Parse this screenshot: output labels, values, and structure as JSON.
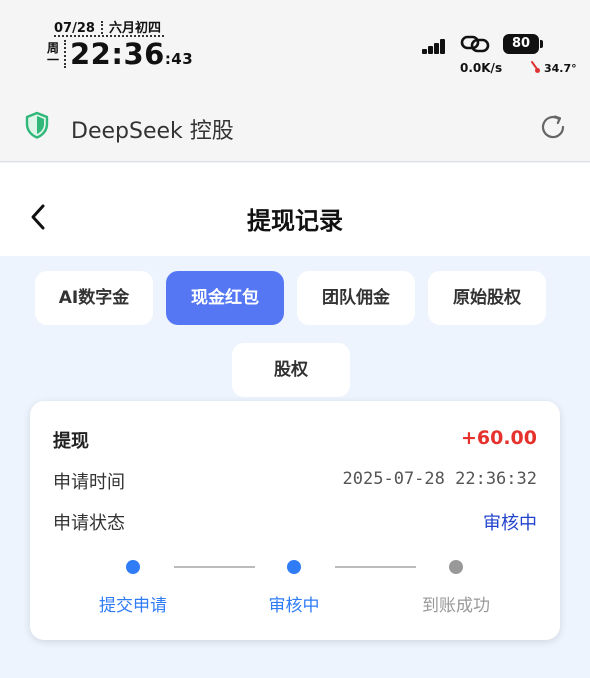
{
  "status_bar": {
    "date": "07/28",
    "lunar": "六月初四",
    "weekday": "周一",
    "time": "22:36",
    "seconds": ":43",
    "network_speed": "0.0K/s",
    "battery": "80",
    "temperature": "34.7°",
    "icons": [
      "signal-icon",
      "link-icon",
      "battery-icon",
      "thermometer-icon"
    ]
  },
  "app_bar": {
    "title": "DeepSeek 控股",
    "icons": [
      "shield-icon",
      "refresh-icon"
    ]
  },
  "header": {
    "title": "提现记录",
    "back_icon": "chevron-left-icon"
  },
  "tabs": [
    {
      "label": "AI数字金",
      "active": false
    },
    {
      "label": "现金红包",
      "active": true
    },
    {
      "label": "团队佣金",
      "active": false
    },
    {
      "label": "原始股权",
      "active": false
    },
    {
      "label": "股权",
      "active": false
    }
  ],
  "record": {
    "type_label": "提现",
    "amount": "+60.00",
    "time_label": "申请时间",
    "time_value": "2025-07-28 22:36:32",
    "status_label": "申请状态",
    "status_value": "审核中",
    "steps": [
      {
        "label": "提交申请",
        "done": true
      },
      {
        "label": "审核中",
        "done": true
      },
      {
        "label": "到账成功",
        "done": false
      }
    ]
  },
  "colors": {
    "accent": "#5577f4",
    "step_done": "#2f7cf6",
    "step_pending": "#999999",
    "amount": "#e5322d",
    "status": "#2244cc"
  }
}
